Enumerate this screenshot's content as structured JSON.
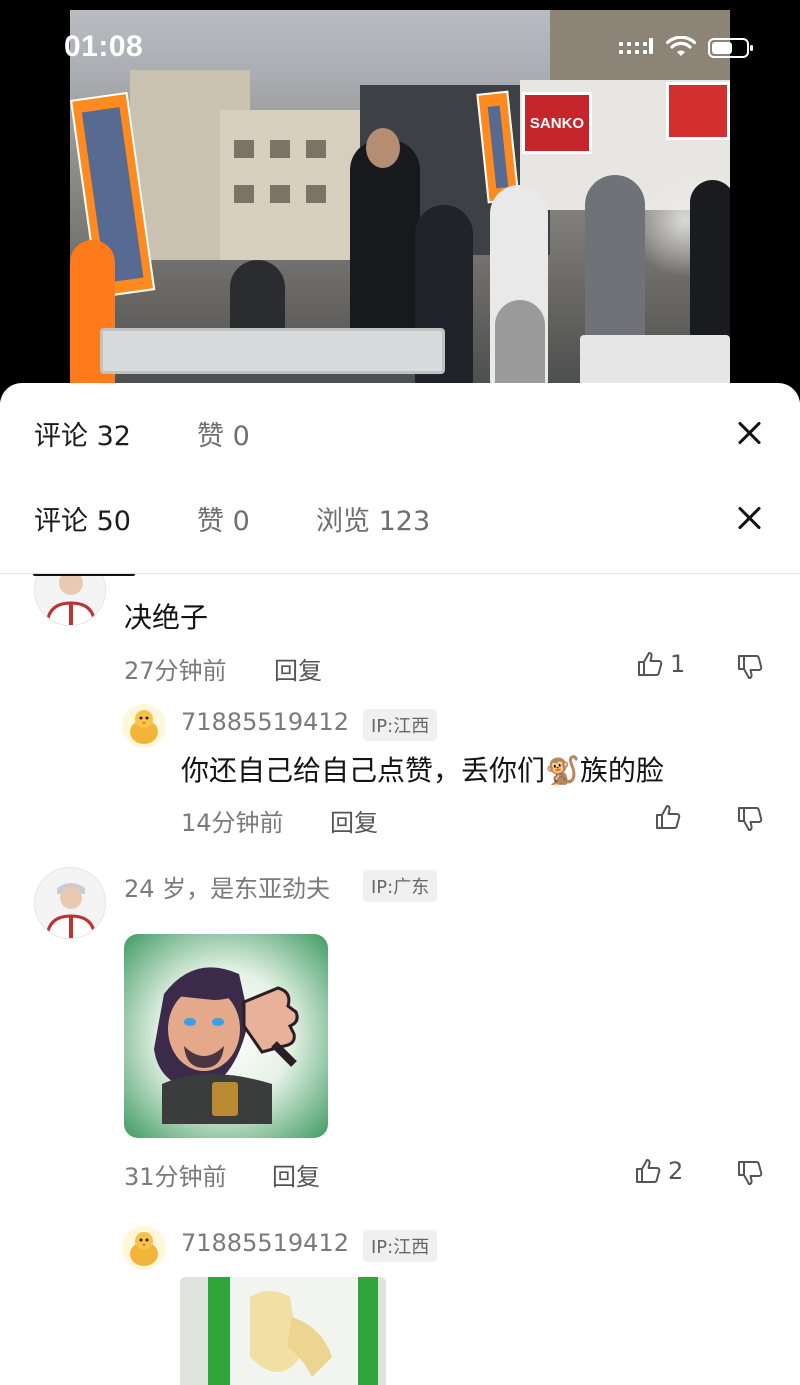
{
  "status_bar": {
    "time": "01:08"
  },
  "video": {
    "store_sign": "SANKO"
  },
  "sheet": {
    "header_primary": {
      "comments_label": "评论 32",
      "likes_label": "赞 0"
    },
    "header_secondary": {
      "comments_label": "评论 50",
      "likes_label": "赞 0",
      "views_label": "浏览 123"
    }
  },
  "comments": [
    {
      "text": "决绝子",
      "time": "27分钟前",
      "reply_label": "回复",
      "likes": "1"
    },
    {
      "username": "71885519412",
      "ip": "IP:江西",
      "text_before_emoji": "你还自己给自己点赞，丢你们",
      "emoji": "🐒",
      "text_after_emoji": "族的脸",
      "time": "14分钟前",
      "reply_label": "回复"
    },
    {
      "username": "24 岁，是东亚劲夫",
      "ip": "IP:广东",
      "sticker": "thumbs-down-sticker",
      "time": "31分钟前",
      "reply_label": "回复",
      "likes": "2"
    },
    {
      "username": "71885519412",
      "ip": "IP:江西"
    }
  ],
  "colors": {
    "accent": "#111111",
    "muted_text": "#7a7a7a",
    "badge_bg": "#f0f0f0",
    "banner_orange": "#ff8a1f",
    "sign_red": "#c5262c"
  }
}
